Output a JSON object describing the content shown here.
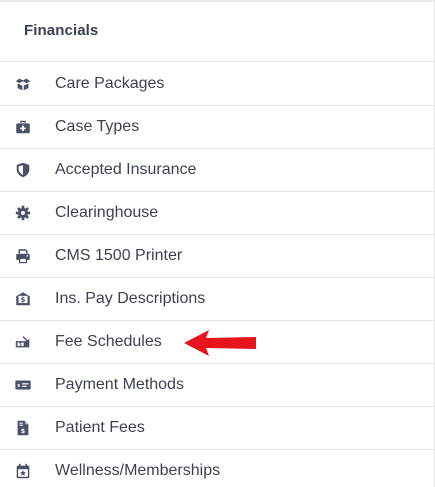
{
  "header": {
    "title": "Financials"
  },
  "menu": {
    "items": [
      {
        "label": "Care Packages",
        "icon": "box-open-icon"
      },
      {
        "label": "Case Types",
        "icon": "medkit-icon"
      },
      {
        "label": "Accepted Insurance",
        "icon": "shield-icon"
      },
      {
        "label": "Clearinghouse",
        "icon": "gear-icon"
      },
      {
        "label": "CMS 1500 Printer",
        "icon": "printer-icon"
      },
      {
        "label": "Ins. Pay Descriptions",
        "icon": "money-envelope-icon"
      },
      {
        "label": "Fee Schedules",
        "icon": "price-slip-icon"
      },
      {
        "label": "Payment Methods",
        "icon": "money-check-icon"
      },
      {
        "label": "Patient Fees",
        "icon": "invoice-dollar-icon"
      },
      {
        "label": "Wellness/Memberships",
        "icon": "calendar-star-icon"
      }
    ]
  },
  "annotation": {
    "icon": "red-arrow-icon",
    "color": "#e8141c",
    "points_to": "Fee Schedules"
  },
  "colors": {
    "icon": "#4a4f6a",
    "text": "#3d4252",
    "divider": "#e3e5ea"
  }
}
